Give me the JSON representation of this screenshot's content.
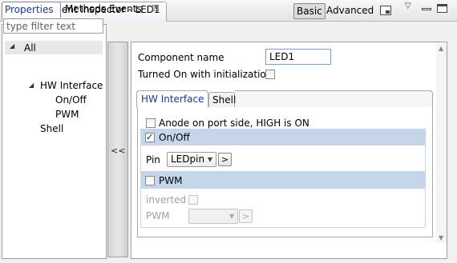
{
  "window": {
    "title": "Component Inspector - LED1",
    "close_glyph": "☒",
    "basic_label": "Basic",
    "advanced_label": "Advanced",
    "menu_glyph": "▽"
  },
  "left_panel": {
    "tabs": [
      {
        "label": "Properties",
        "active": true
      },
      {
        "label": "Methods",
        "active": false
      },
      {
        "label": "Events",
        "active": false
      }
    ],
    "filter_placeholder": "type filter text",
    "tree": {
      "root": {
        "label": "All",
        "expanded_glyph": "◢"
      },
      "items": [
        {
          "label": "HW Interface",
          "expanded_glyph": "◢"
        },
        {
          "label": "On/Off"
        },
        {
          "label": "PWM"
        },
        {
          "label": "Shell"
        }
      ]
    }
  },
  "splitter": {
    "collapse_label": "<<"
  },
  "form": {
    "component_name_label": "Component name",
    "component_name_value": "LED1",
    "turned_on_label": "Turned On with initialization",
    "turned_on_checked": false,
    "inner_tabs": [
      {
        "label": "HW Interface",
        "active": true
      },
      {
        "label": "Shell",
        "active": false
      }
    ],
    "anode_label": "Anode on port side, HIGH is ON",
    "anode_checked": false,
    "onoff_group": {
      "label": "On/Off",
      "checked": true,
      "pin_label": "Pin",
      "pin_value": "LEDpin",
      "browse_label": ">"
    },
    "pwm_group": {
      "label": "PWM",
      "checked": false,
      "inverted_label": "inverted",
      "pwm_label": "PWM",
      "pwm_value": "",
      "browse_label": ">"
    }
  },
  "colors": {
    "group_header": "#c5d6ea",
    "active_tab_text": "#1a3a8c"
  }
}
